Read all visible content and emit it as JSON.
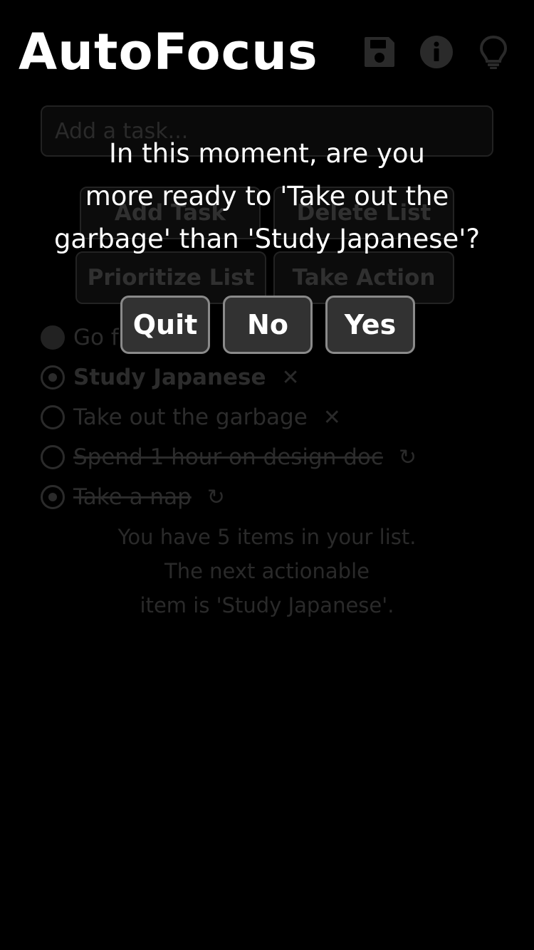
{
  "header": {
    "title": "AutoFocus",
    "icons": [
      "save-icon",
      "info-icon",
      "lightbulb-icon"
    ]
  },
  "background": {
    "task_input_placeholder": "Add a task...",
    "buttons": {
      "add_task": "Add Task",
      "delete_list": "Delete List",
      "prioritize_list": "Prioritize List",
      "take_action": "Take Action"
    },
    "tasks": [
      {
        "label": "Go f",
        "state": "filled"
      },
      {
        "label": "Study Japanese",
        "state": "dotted",
        "bold": true,
        "action": "✕"
      },
      {
        "label": "Take out the garbage",
        "state": "empty",
        "action": "✕"
      },
      {
        "label": "Spend 1 hour on design doc",
        "state": "empty",
        "strike": true,
        "action": "↻"
      },
      {
        "label": "Take a nap",
        "state": "dotted",
        "strike": true,
        "action": "↻"
      }
    ],
    "summary": {
      "line1": "You have 5 items in your list.",
      "line2": "The next actionable",
      "line3": "item is 'Study Japanese'."
    }
  },
  "dialog": {
    "line1": "In this moment, are you",
    "line2": "more ready to 'Take out the",
    "line3": "garbage' than 'Study Japanese'?",
    "quit": "Quit",
    "no": "No",
    "yes": "Yes"
  },
  "colors": {
    "background": "#000000",
    "dialog_button": "#323232",
    "dialog_button_border": "#8a8a8a",
    "dimmed_text": "#2c2c2c"
  }
}
